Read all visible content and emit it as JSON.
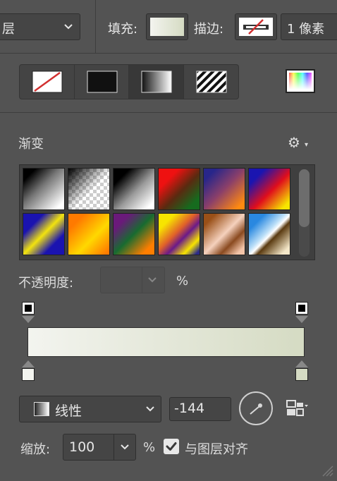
{
  "topbar": {
    "layer_select_label": "层",
    "fill_label": "填充:",
    "stroke_label": "描边:",
    "stroke_width": "1 像素"
  },
  "fill_types": [
    {
      "name": "none",
      "icon": "no-fill-icon"
    },
    {
      "name": "solid",
      "icon": "solid-color-icon"
    },
    {
      "name": "gradient",
      "icon": "gradient-icon",
      "active": true
    },
    {
      "name": "pattern",
      "icon": "pattern-icon"
    }
  ],
  "gradient_panel": {
    "title": "渐变",
    "opacity_label": "不透明度:",
    "opacity_unit": "%",
    "style_label": "线性",
    "angle_value": "-144",
    "scale_label": "缩放:",
    "scale_value": "100",
    "scale_unit": "%",
    "align_label": "与图层对齐",
    "align_checked": true
  },
  "colors": {
    "fill_gradient_start": "#f3f4ef",
    "fill_gradient_end": "#d5dbc3",
    "panel_bg": "#535353",
    "stroke_red": "#d23030"
  },
  "presets": [
    "black-white",
    "transparent-checker",
    "black-white-2",
    "red-green",
    "blue-orange",
    "blue-red-yellow",
    "blue-yellow-blue",
    "orange-yellow",
    "violet-green-orange",
    "yellow-violet",
    "copper",
    "chrome"
  ]
}
